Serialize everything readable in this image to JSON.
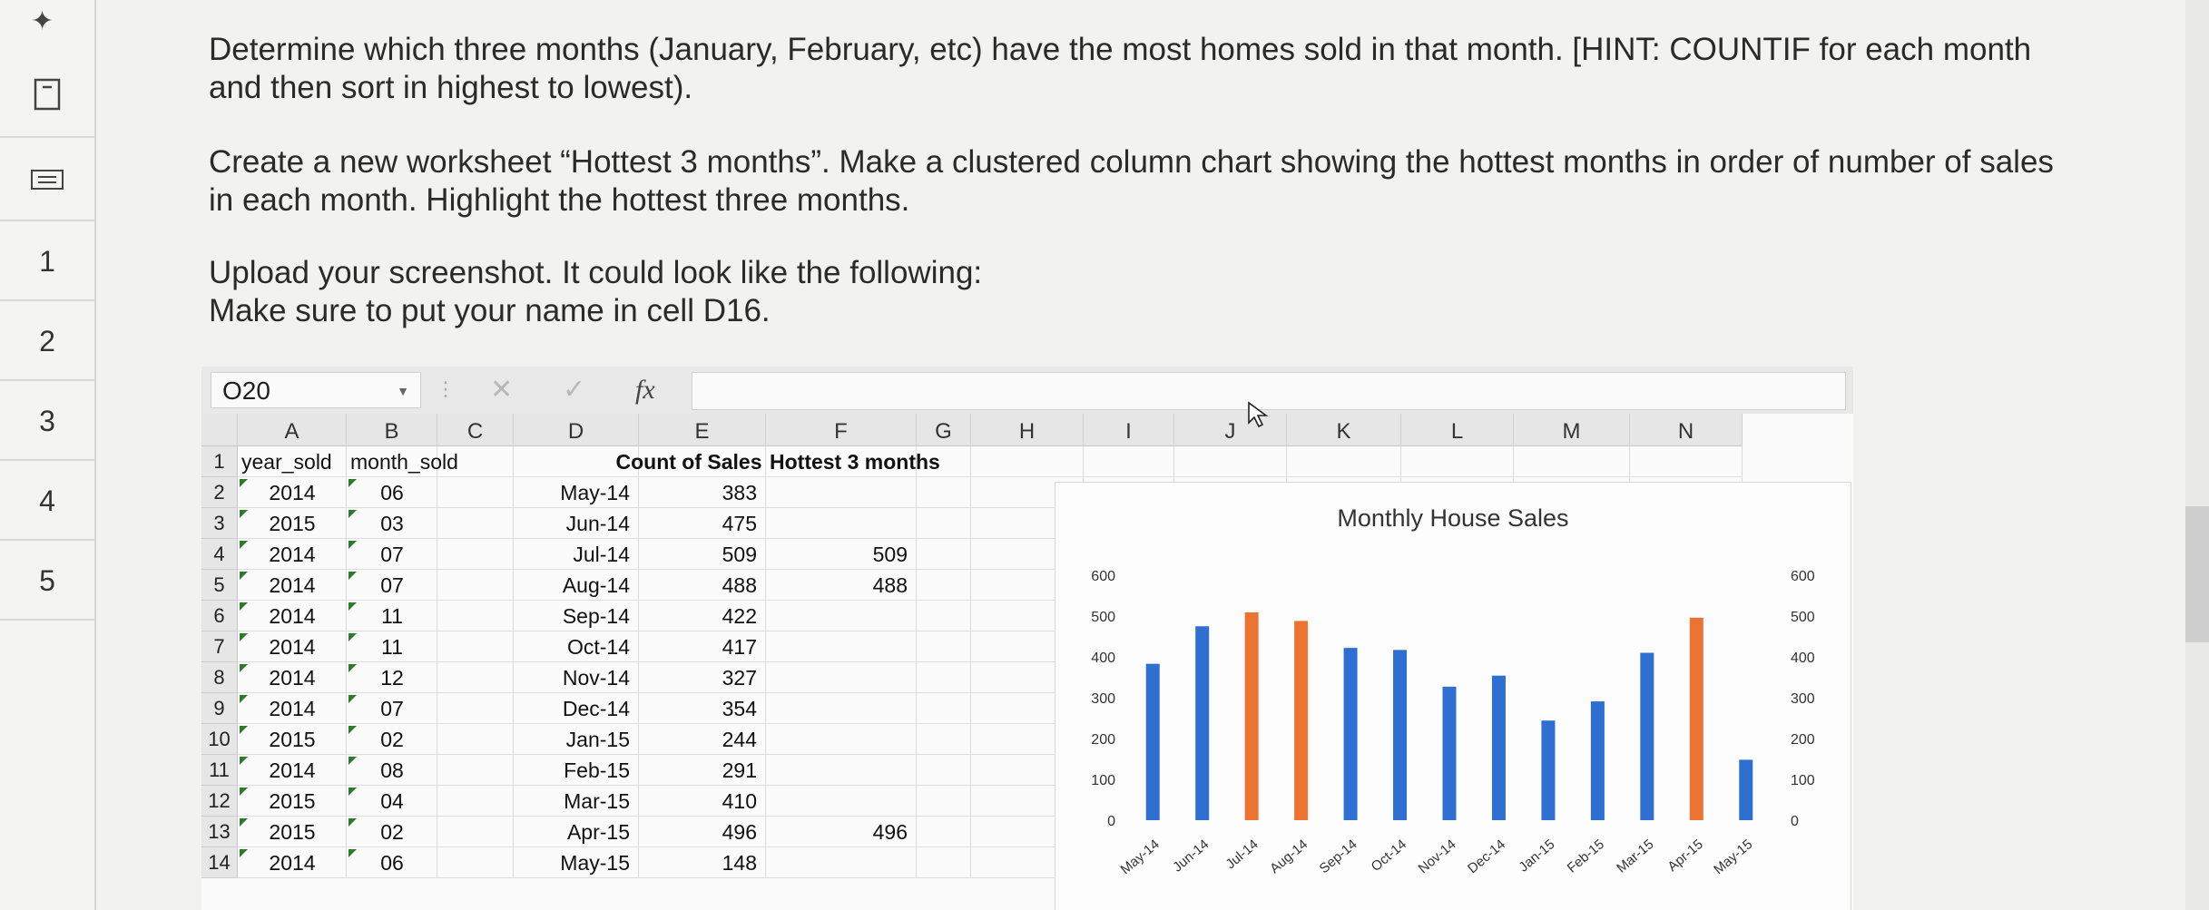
{
  "gutter": {
    "pin_icon": "pin-icon",
    "rows": [
      {
        "label": "",
        "icon": "book-icon"
      },
      {
        "label": "",
        "icon": "card-icon"
      },
      {
        "label": "1"
      },
      {
        "label": "2"
      },
      {
        "label": "3"
      },
      {
        "label": "4"
      },
      {
        "label": "5"
      }
    ]
  },
  "question": {
    "p1_line1": "Determine which three months (January, February, etc) have the most homes sold in that month. [HINT: COUNTIF for each month",
    "p1_line2": "and then sort in highest to lowest).",
    "p2_line1": "Create a new worksheet “Hottest 3 months”. Make a clustered column chart showing the hottest months in order of number of sales",
    "p2_line2": "in each month. Highlight the hottest three months.",
    "p3_line1": "Upload your screenshot. It could look like the following:",
    "p3_line2": "Make sure to put your name in cell D16."
  },
  "formula_bar": {
    "name_box": "O20",
    "cancel": "✕",
    "enter": "✓",
    "fx": "fx",
    "value": ""
  },
  "columns": [
    "A",
    "B",
    "C",
    "D",
    "E",
    "F",
    "G",
    "H",
    "I",
    "J",
    "K",
    "L",
    "M",
    "N"
  ],
  "sheet": {
    "headers": {
      "A": "year_sold",
      "B": "month_sold",
      "E": "Count of Sales",
      "F": "Hottest 3 months"
    },
    "rows": [
      {
        "n": "1"
      },
      {
        "n": "2",
        "A": "2014",
        "B": "06",
        "D": "May-14",
        "E": "383",
        "F": ""
      },
      {
        "n": "3",
        "A": "2015",
        "B": "03",
        "D": "Jun-14",
        "E": "475",
        "F": ""
      },
      {
        "n": "4",
        "A": "2014",
        "B": "07",
        "D": "Jul-14",
        "E": "509",
        "F": "509"
      },
      {
        "n": "5",
        "A": "2014",
        "B": "07",
        "D": "Aug-14",
        "E": "488",
        "F": "488"
      },
      {
        "n": "6",
        "A": "2014",
        "B": "11",
        "D": "Sep-14",
        "E": "422",
        "F": ""
      },
      {
        "n": "7",
        "A": "2014",
        "B": "11",
        "D": "Oct-14",
        "E": "417",
        "F": ""
      },
      {
        "n": "8",
        "A": "2014",
        "B": "12",
        "D": "Nov-14",
        "E": "327",
        "F": ""
      },
      {
        "n": "9",
        "A": "2014",
        "B": "07",
        "D": "Dec-14",
        "E": "354",
        "F": ""
      },
      {
        "n": "10",
        "A": "2015",
        "B": "02",
        "D": "Jan-15",
        "E": "244",
        "F": ""
      },
      {
        "n": "11",
        "A": "2014",
        "B": "08",
        "D": "Feb-15",
        "E": "291",
        "F": ""
      },
      {
        "n": "12",
        "A": "2015",
        "B": "04",
        "D": "Mar-15",
        "E": "410",
        "F": ""
      },
      {
        "n": "13",
        "A": "2015",
        "B": "02",
        "D": "Apr-15",
        "E": "496",
        "F": "496"
      },
      {
        "n": "14",
        "A": "2014",
        "B": "06",
        "D": "May-15",
        "E": "148",
        "F": ""
      }
    ]
  },
  "chart_data": {
    "type": "bar",
    "title": "Monthly House Sales",
    "categories": [
      "May-14",
      "Jun-14",
      "Jul-14",
      "Aug-14",
      "Sep-14",
      "Oct-14",
      "Nov-14",
      "Dec-14",
      "Jan-15",
      "Feb-15",
      "Mar-15",
      "Apr-15",
      "May-15"
    ],
    "values": [
      383,
      475,
      509,
      488,
      422,
      417,
      327,
      354,
      244,
      291,
      410,
      496,
      148
    ],
    "highlighted": [
      false,
      false,
      true,
      true,
      false,
      false,
      false,
      false,
      false,
      false,
      false,
      true,
      false
    ],
    "ylim": [
      0,
      600
    ],
    "yticks": [
      0,
      100,
      200,
      300,
      400,
      500,
      600
    ],
    "xlabel": "",
    "ylabel": "",
    "grid": false,
    "colors": {
      "normal": "#2f6fd1",
      "highlight": "#ed7330"
    }
  }
}
